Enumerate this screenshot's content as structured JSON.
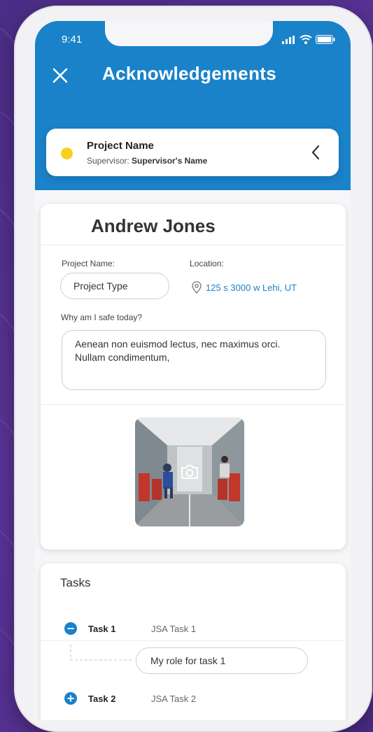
{
  "status_bar": {
    "time": "9:41"
  },
  "header": {
    "title": "Acknowledgements"
  },
  "project": {
    "name": "Project Name",
    "supervisor_label": "Supervisor: ",
    "supervisor_name": "Supervisor's Name",
    "status_color": "#f6d21e"
  },
  "acknowledgement": {
    "person": "Andrew Jones",
    "project_name_label": "Project Name:",
    "project_type_value": "Project Type",
    "location_label": "Location:",
    "location_value": "125 s 3000 w Lehi, UT",
    "safe_label": "Why am I safe today?",
    "safe_text": "Aenean non euismod lectus, nec maximus orci. Nullam condimentum,",
    "photo_icon": "camera-icon"
  },
  "tasks": {
    "title": "Tasks",
    "items": [
      {
        "name": "Task 1",
        "jsa": "JSA  Task 1",
        "expanded": true,
        "role": "My role for task 1"
      },
      {
        "name": "Task 2",
        "jsa": "JSA  Task 2",
        "expanded": false
      }
    ]
  },
  "colors": {
    "primary": "#1a82c9",
    "accent": "#f6d21e",
    "background": "#5b3497"
  }
}
